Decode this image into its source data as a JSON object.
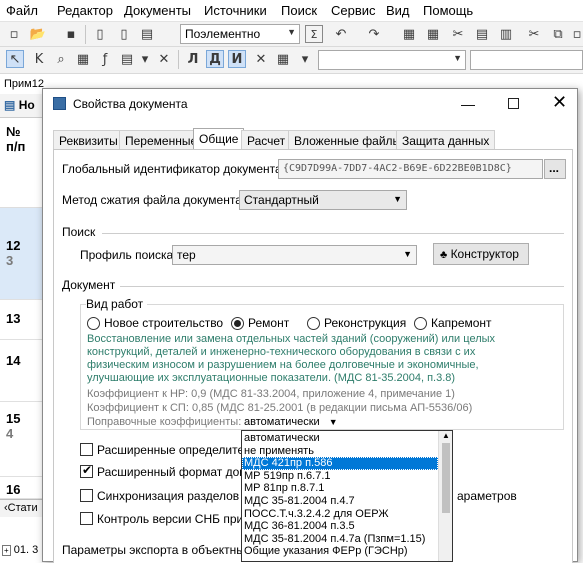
{
  "menu": [
    "Файл",
    "Редактор",
    "Документы",
    "Источники",
    "Поиск",
    "Сервис",
    "Вид",
    "Помощь"
  ],
  "toolbar": {
    "mode_combo": "Поэлементно",
    "print_icons": "✉"
  },
  "background": {
    "doc_label": "Прим12",
    "tab_label": "Но",
    "header_num": "№",
    "header_pp": "п/п",
    "rows": [
      {
        "num": "12",
        "sub": "3"
      },
      {
        "num": "13",
        "sub": ""
      },
      {
        "num": "14",
        "sub": ""
      },
      {
        "num": "15",
        "sub": "4"
      },
      {
        "num": "16",
        "sub": ""
      }
    ],
    "bottom_tab": "Стати",
    "bottom_item": "01. 3"
  },
  "dialog": {
    "title": "Свойства документа",
    "tabs": [
      "Реквизиты",
      "Переменные",
      "Общие",
      "Расчет",
      "Вложенные файлы",
      "Защита данных"
    ],
    "active_tab": "Общие",
    "guid_label": "Глобальный идентификатор документа:",
    "guid_value": "{C9D7D99A-7DD7-4AC2-B69E-6D22BE0B1D8C}",
    "guid_button": "...",
    "compress_label": "Метод сжатия файла документа:",
    "compress_value": "Стандартный",
    "search_group": "Поиск",
    "search_profile_label": "Профиль поиска:",
    "search_profile_value": "тер",
    "constructor_button": "Конструктор",
    "document_group": "Документ",
    "work_type_group": "Вид работ",
    "radios": [
      "Новое строительство",
      "Ремонт",
      "Реконструкция",
      "Капремонт"
    ],
    "radio_selected": "Ремонт",
    "description": "Восстановление или замена отдельных частей зданий (сооружений) или целых конструкций, деталей и инженерно-технического оборудования в связи с их физическим износом и разрушением на более долговечные и экономичные, улучшающие их эксплуатационные показатели. (МДС 81-35.2004, п.3.8)",
    "coef_nr": "Коэффициент к НР: 0,9 (МДС 81-33.2004, приложение 4, примечание 1)",
    "coef_sp": "Коэффициент к СП: 0,85 (МДС 81-25.2001 (в редакции письма АП-5536/06)",
    "correction_label": "Поправочные коэффициенты:",
    "correction_value": "автоматически",
    "checkboxes": [
      {
        "label": "Расширенные определители",
        "checked": false
      },
      {
        "label": "Расширенный формат докум",
        "checked": true
      },
      {
        "label": "Синхронизация разделов таб",
        "checked": false
      },
      {
        "label": "Контроль версии СНБ при пер",
        "checked": false
      }
    ],
    "checkbox_tail": "араметров",
    "export_group": "Параметры экспорта в объектные"
  },
  "dropdown": {
    "items": [
      "автоматически",
      "не применять",
      "МДС 421пр п.586",
      "МР 519пр п.6.7.1",
      "МР 81пр п.8.7.1",
      "МДС 35-81.2004 п.4.7",
      "ПОСС.Т.ч.3.2.4.2 для ОЕРЖ",
      "МДС 36-81.2004 п.3.5",
      "МДС 35-81.2004 п.4.7а (Пзпм=1.15)",
      "Общие указания ФЕРр (ГЭСНр)"
    ],
    "selected_index": 2
  },
  "colors": {
    "accent": "#0078d7",
    "description": "#2e7d6b",
    "grey_text": "#7a7a7a",
    "row_highlight": "#dbe9f8"
  }
}
